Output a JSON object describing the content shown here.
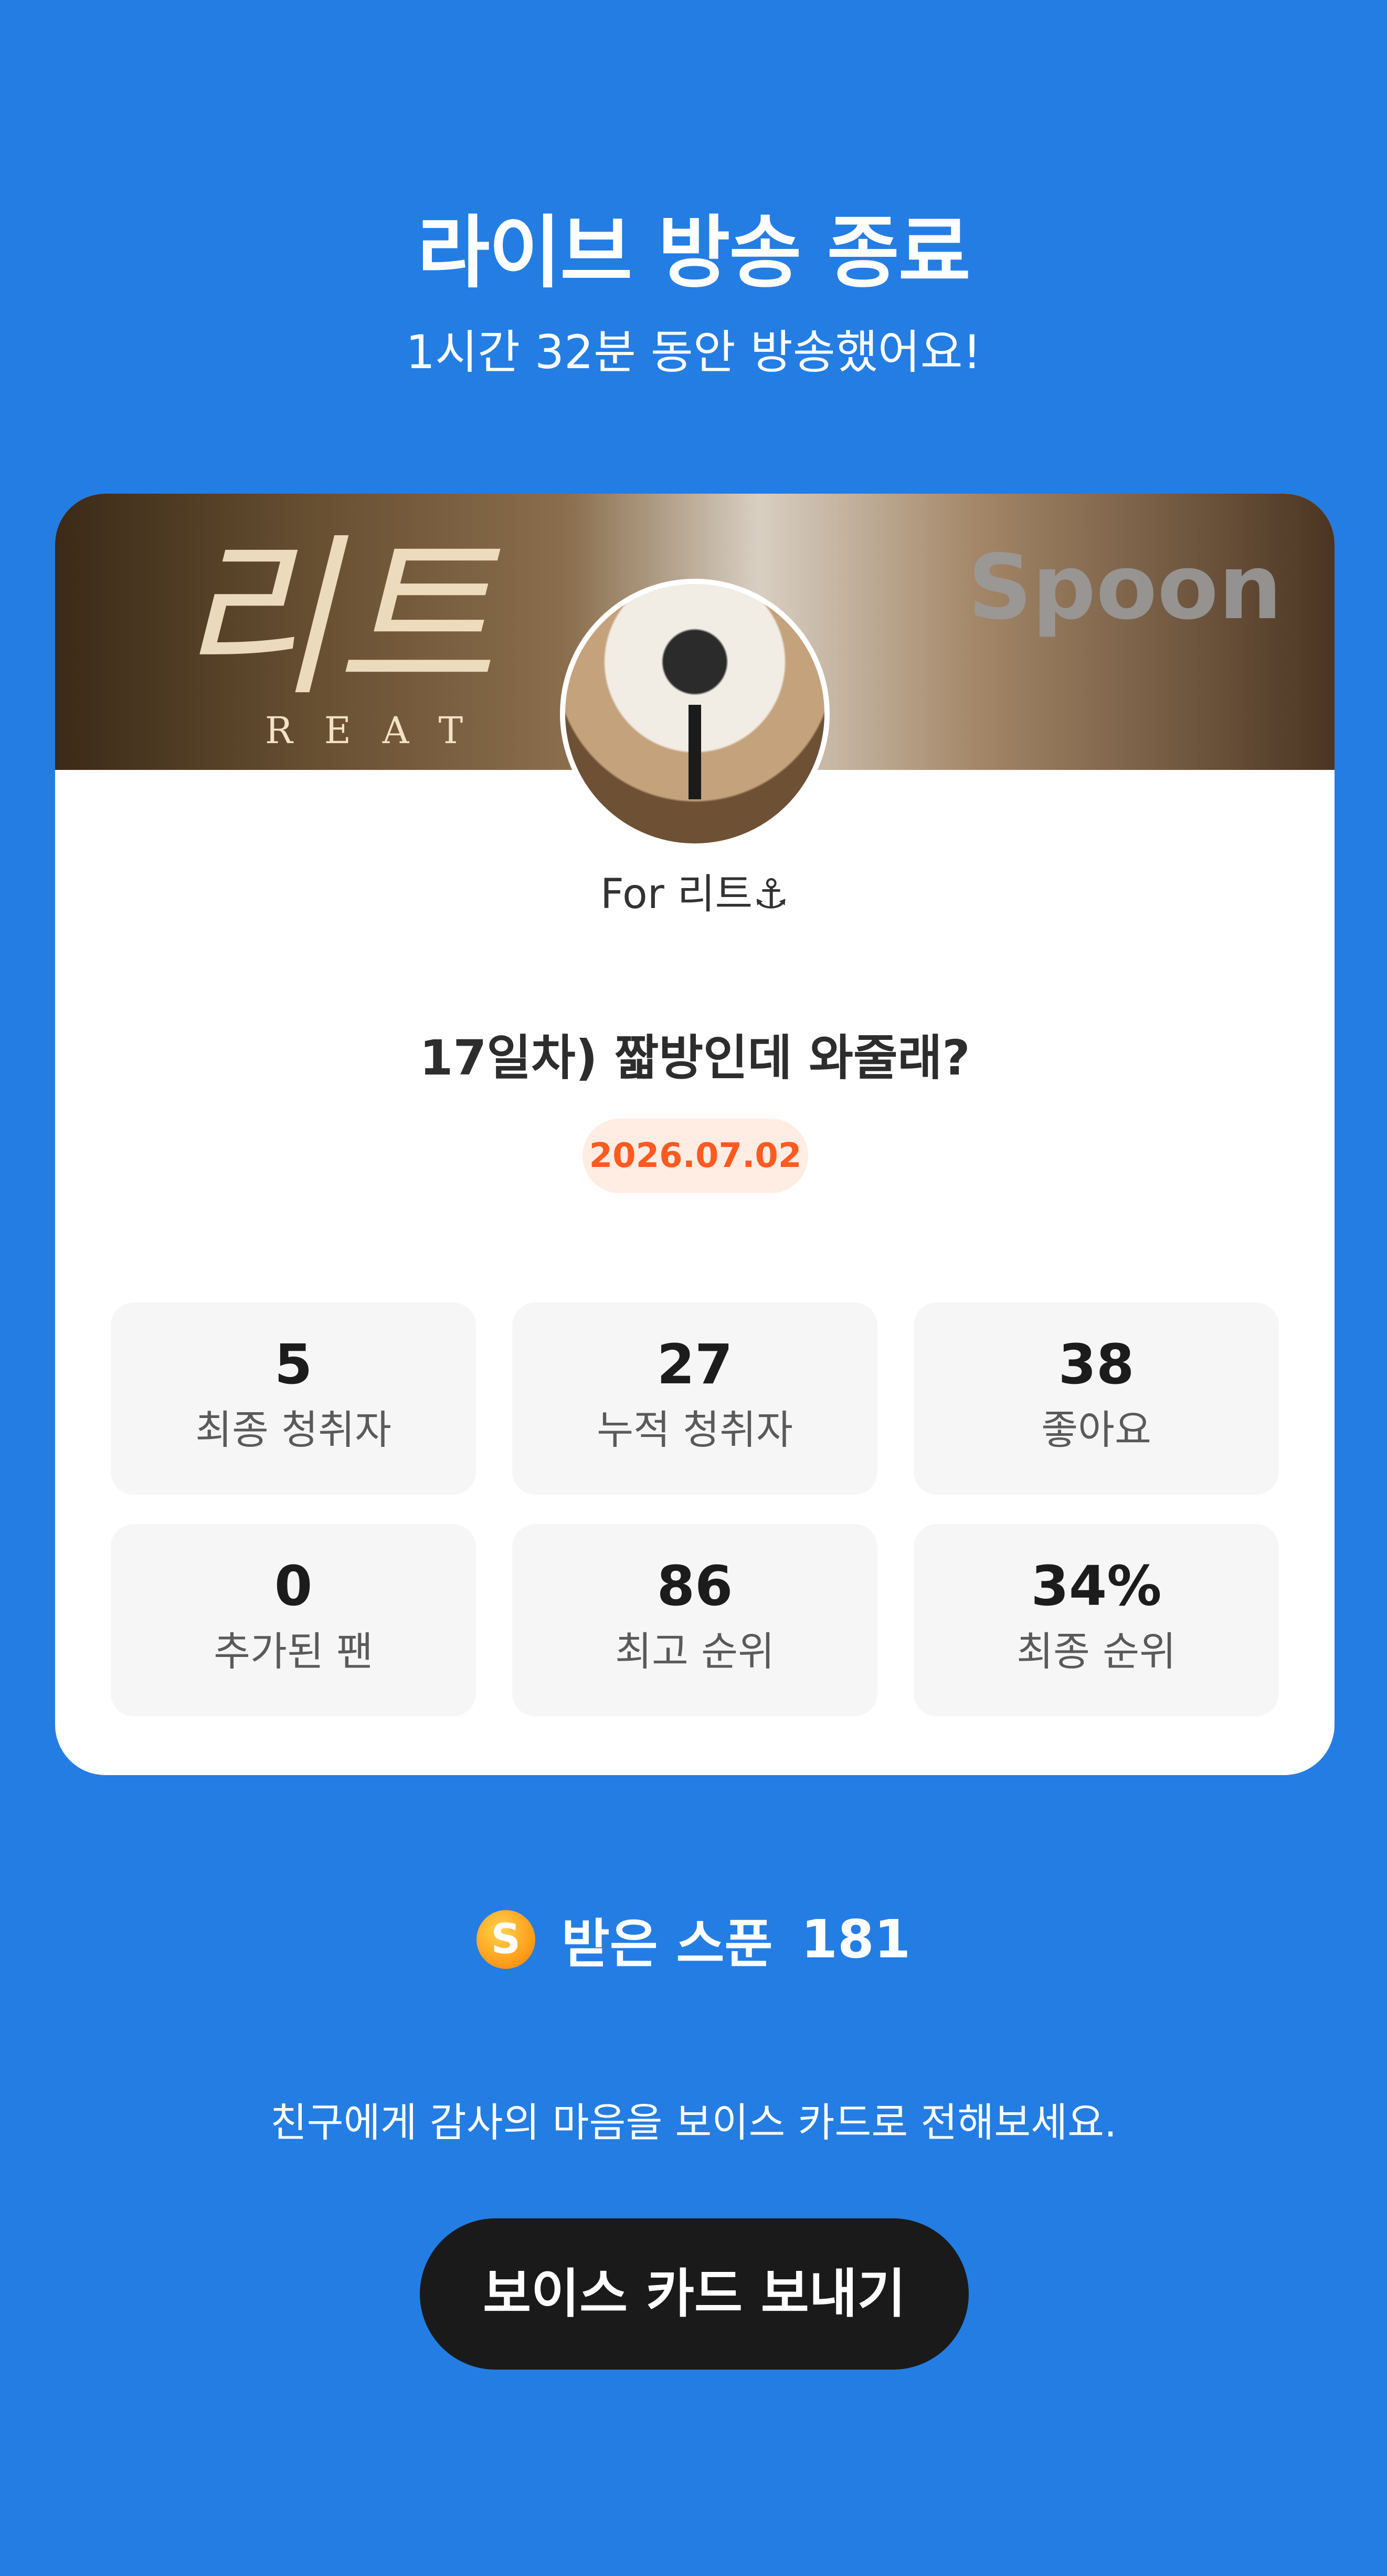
{
  "header": {
    "title": "라이브 방송 종료",
    "subtitle": "1시간 32분 동안 방송했어요!"
  },
  "card": {
    "banner": {
      "script_text": "리트",
      "sub_text": "REAT",
      "brand": "Spoon"
    },
    "author": "For  리트⚓",
    "live_title": "17일차) 짧방인데 와줄래?",
    "date": "2026.07.02",
    "stats": [
      {
        "value": "5",
        "label": "최종 청취자"
      },
      {
        "value": "27",
        "label": "누적 청취자"
      },
      {
        "value": "38",
        "label": "좋아요"
      },
      {
        "value": "0",
        "label": "추가된 팬"
      },
      {
        "value": "86",
        "label": "최고 순위"
      },
      {
        "value": "34%",
        "label": "최종 순위"
      }
    ]
  },
  "spoons": {
    "icon_letter": "S",
    "label": "받은 스푼",
    "count": "181"
  },
  "footer": {
    "message": "친구에게 감사의 마음을 보이스 카드로 전해보세요.",
    "button_label": "보이스 카드 보내기"
  }
}
